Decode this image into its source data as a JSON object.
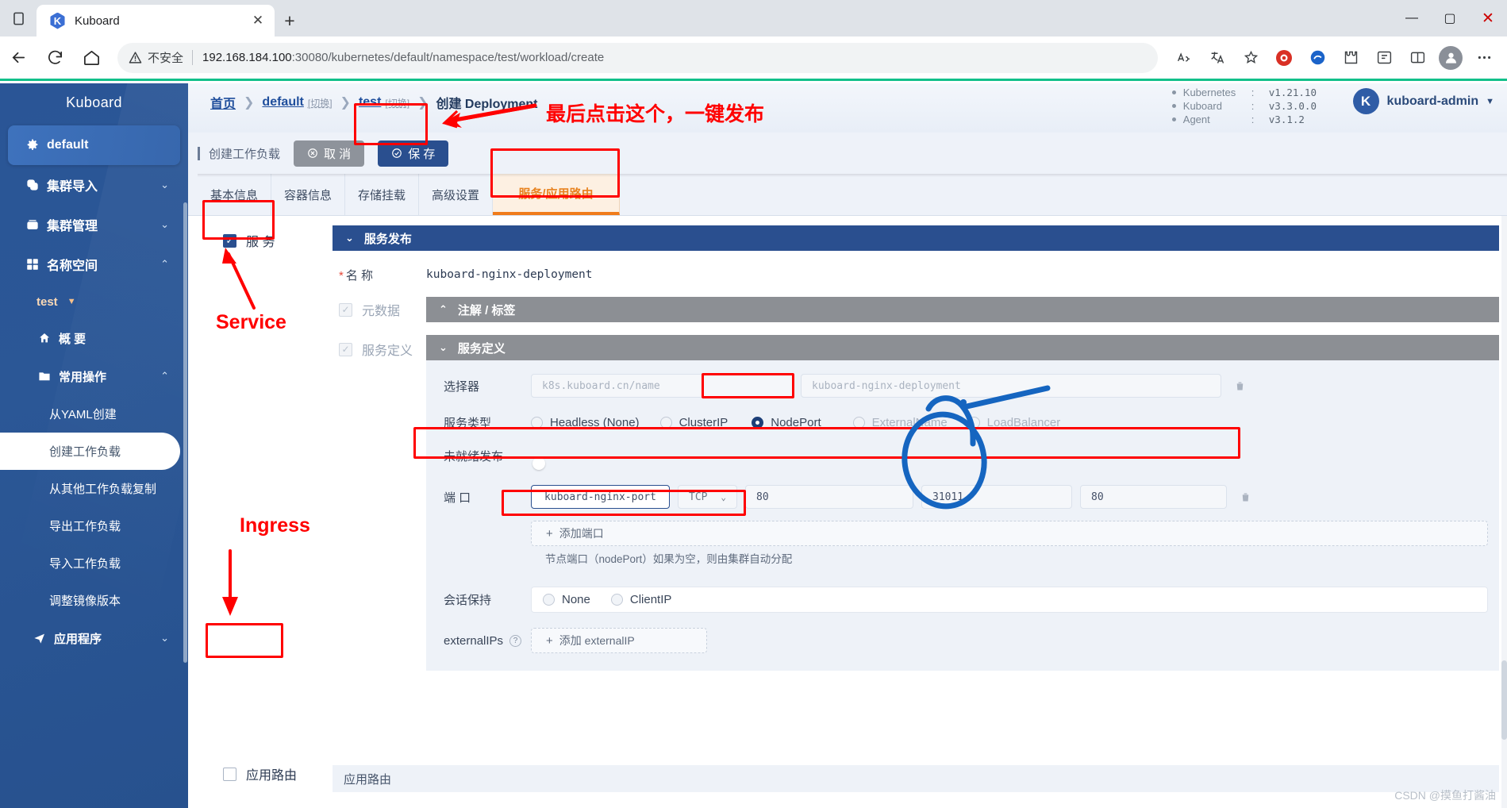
{
  "browser": {
    "tab_title": "Kuboard",
    "favicon_letter": "K",
    "new_tab_label": "+",
    "close_tab_label": "✕",
    "security_label": "不安全",
    "url_host": "192.168.184.100",
    "url_rest": ":30080/kubernetes/default/namespace/test/workload/create",
    "minimize_label": "—",
    "maximize_label": "▢",
    "window_close_label": "✕"
  },
  "sidebar": {
    "brand": "Kuboard",
    "items": [
      {
        "label": "default",
        "icon": "gear-icon",
        "state": "active",
        "chevron": ""
      },
      {
        "label": "集群导入",
        "icon": "clusters-import-icon",
        "state": "normal",
        "chevron": "⌄"
      },
      {
        "label": "集群管理",
        "icon": "cluster-manage-icon",
        "state": "normal",
        "chevron": "⌄"
      },
      {
        "label": "名称空间",
        "icon": "namespace-grid-icon",
        "state": "normal",
        "chevron": "⌃"
      }
    ],
    "namespace": {
      "label": "test",
      "caret": "▼"
    },
    "overview": {
      "label": "概 要",
      "icon": "home-icon"
    },
    "common_ops": {
      "label": "常用操作",
      "icon": "folder-icon",
      "chevron": "⌃"
    },
    "leaves": [
      {
        "label": "从YAML创建",
        "selected": false
      },
      {
        "label": "创建工作负载",
        "selected": true
      },
      {
        "label": "从其他工作负载复制",
        "selected": false
      },
      {
        "label": "导出工作负载",
        "selected": false
      },
      {
        "label": "导入工作负载",
        "selected": false
      },
      {
        "label": "调整镜像版本",
        "selected": false
      }
    ],
    "apps": {
      "label": "应用程序",
      "icon": "send-icon",
      "chevron": "⌄"
    }
  },
  "header": {
    "breadcrumb": {
      "home": "首页",
      "cluster": "default",
      "cluster_switch": "[切换]",
      "namespace": "test",
      "namespace_switch": "[切换]",
      "current": "创建 Deployment",
      "separator": "❯"
    },
    "versions": [
      {
        "name": "Kubernetes",
        "colon": ":",
        "value": "v1.21.10"
      },
      {
        "name": "Kuboard",
        "colon": ":",
        "value": "v3.3.0.0"
      },
      {
        "name": "Agent",
        "colon": ":",
        "value": "v3.1.2"
      }
    ],
    "user": {
      "avatar_letter": "K",
      "name": "kuboard-admin",
      "caret": "▼"
    }
  },
  "actions": {
    "page_tag": "创建工作负载",
    "cancel_label": "取 消",
    "save_label": "保 存"
  },
  "tabs": [
    {
      "label": "基本信息",
      "active": false
    },
    {
      "label": "容器信息",
      "active": false
    },
    {
      "label": "存储挂载",
      "active": false
    },
    {
      "label": "高级设置",
      "active": false
    },
    {
      "label": "服务/应用路由",
      "active": true
    }
  ],
  "form": {
    "service_checkbox": {
      "label": "服 务",
      "checked": true
    },
    "ingress_checkbox": {
      "label": "应用路由",
      "checked": false
    },
    "ingress_panel_label": "应用路由",
    "panel_publish_title": "服务发布",
    "panel_publish_caret": "⌄",
    "name_label": "名 称",
    "name_required_star": "*",
    "name_value": "kuboard-nginx-deployment",
    "metadata_checkbox": {
      "label": "元数据",
      "checked": true
    },
    "annotations_panel_title": "注解 / 标签",
    "annotations_panel_caret": "⌃",
    "servicedef_checkbox": {
      "label": "服务定义",
      "checked": true
    },
    "servicedef_panel_title": "服务定义",
    "servicedef_panel_caret": "⌄",
    "selector_label": "选择器",
    "selector_key_placeholder": "k8s.kuboard.cn/name",
    "selector_value_placeholder": "kuboard-nginx-deployment",
    "service_type_label": "服务类型",
    "service_types": [
      {
        "label": "Headless (None)",
        "selected": false,
        "disabled": false
      },
      {
        "label": "ClusterIP",
        "selected": false,
        "disabled": false
      },
      {
        "label": "NodePort",
        "selected": true,
        "disabled": false
      },
      {
        "label": "ExternalName",
        "selected": false,
        "disabled": true
      },
      {
        "label": "LoadBalancer",
        "selected": false,
        "disabled": true
      }
    ],
    "unready_label": "未就绪发布",
    "unready_on": false,
    "ports_label": "端 口",
    "port_row": {
      "name": "kuboard-nginx-port",
      "protocol": "TCP",
      "protocol_caret": "⌄",
      "port": "80",
      "node_port": "31011",
      "target_port": "80"
    },
    "add_port_label": "添加端口",
    "add_port_plus": "+",
    "node_port_hint": "节点端口（nodePort）如果为空，则由集群自动分配",
    "session_label": "会话保持",
    "session_options": [
      {
        "label": "None",
        "selected": false
      },
      {
        "label": "ClientIP",
        "selected": false
      }
    ],
    "external_ips_label": "externalIPs",
    "add_external_ip_label": "添加 externalIP",
    "add_external_ip_plus": "+"
  },
  "annotations": {
    "publish_note": "最后点击这个，一键发布",
    "service_note": "Service",
    "ingress_note": "Ingress"
  },
  "watermark": "CSDN @摸鱼打酱油",
  "colors": {
    "sidebar_blue": "#2b5796",
    "primary_blue": "#2a4f8f",
    "accent_orange": "#f07c1b",
    "annotation_red": "#ff0000",
    "annotation_blue": "#1565c0",
    "green_bar": "#12c08a"
  }
}
